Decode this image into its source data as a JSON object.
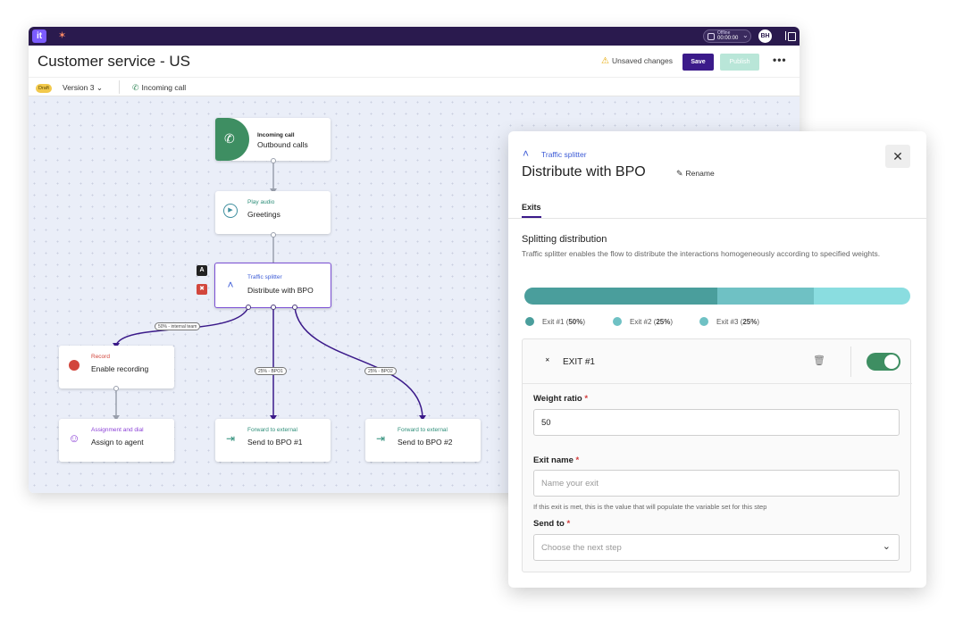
{
  "app": {
    "logo": "it",
    "status_label": "Offline",
    "status_time": "00:00:00",
    "avatar_initials": "BH"
  },
  "header": {
    "title": "Customer service - US",
    "unsaved": "Unsaved changes",
    "save": "Save",
    "publish": "Publish"
  },
  "subheader": {
    "draft": "Draft",
    "version": "Version 3",
    "trigger": "Incoming call"
  },
  "nodes": {
    "incoming": {
      "type": "Incoming call",
      "label": "Outbound calls"
    },
    "play": {
      "type": "Play audio",
      "label": "Greetings"
    },
    "splitter": {
      "type": "Traffic splitter",
      "label": "Distribute with BPO",
      "side_badge": "A"
    },
    "record": {
      "type": "Record",
      "label": "Enable recording"
    },
    "assign": {
      "type": "Assignment and dial",
      "label": "Assign to agent"
    },
    "fwd1": {
      "type": "Forward to external",
      "label": "Send to BPO #1"
    },
    "fwd2": {
      "type": "Forward to external",
      "label": "Send to BPO #2"
    }
  },
  "edge_labels": {
    "internal": "50% - internal team",
    "bpo1": "25% - BPO1",
    "bpo2": "25% - BPO2"
  },
  "colors": {
    "accent": "#3b1a8a",
    "green": "#3e8e62",
    "exit1": "#4a9e9c",
    "exit2": "#6fc1c4",
    "exit3": "#8adde0"
  },
  "detail": {
    "type": "Traffic splitter",
    "title": "Distribute with BPO",
    "rename": "Rename",
    "tab": "Exits",
    "section_title": "Splitting distribution",
    "section_desc": "Traffic splitter enables the flow to distribute the interactions homogeneously according to specified weights.",
    "distribution": [
      {
        "name": "Exit #1",
        "pct": "50%",
        "value": 50
      },
      {
        "name": "Exit #2",
        "pct": "25%",
        "value": 25
      },
      {
        "name": "Exit #3",
        "pct": "25%",
        "value": 25
      }
    ],
    "exit": {
      "title": "EXIT #1",
      "enabled": true,
      "weight_label": "Weight ratio",
      "weight_value": "50",
      "name_label": "Exit name",
      "name_placeholder": "Name your exit",
      "name_help": "If this exit is met, this is the value that will populate the variable set for this step",
      "send_label": "Send to",
      "send_placeholder": "Choose the next step"
    },
    "required_mark": "*"
  }
}
